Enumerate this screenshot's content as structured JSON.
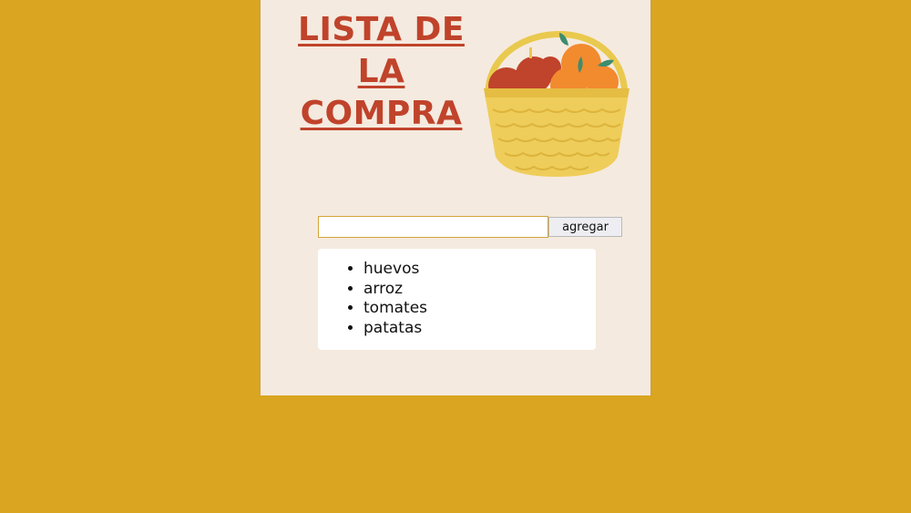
{
  "header": {
    "title_line1": "LISTA DE LA",
    "title_line2": "COMPRA",
    "basket_image": "fruit-basket-illustration"
  },
  "form": {
    "input_value": "",
    "input_placeholder": "",
    "button_label": "agregar"
  },
  "list": {
    "items": [
      "huevos",
      "arroz",
      "tomates",
      "patatas"
    ]
  },
  "colors": {
    "background": "#DAA520",
    "card": "#F5EADF",
    "title": "#C0432B"
  }
}
